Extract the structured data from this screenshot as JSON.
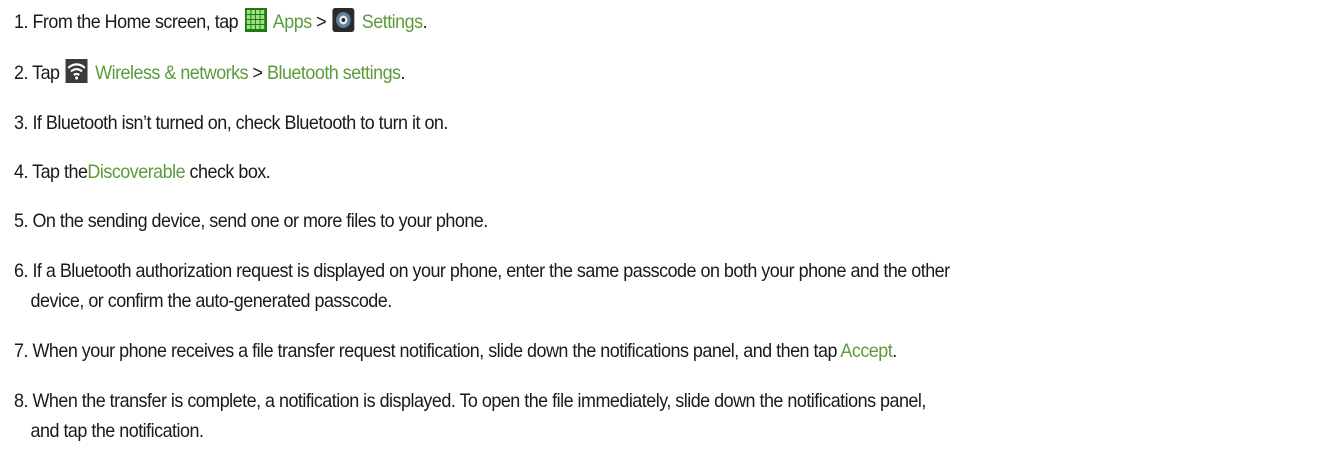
{
  "steps": [
    {
      "number": "1.",
      "text_1": "From the Home screen, tap",
      "icon_1": "apps-grid-icon",
      "link_1": "Apps",
      "sep": ">",
      "icon_2": "settings-gear-icon",
      "link_2": "Settings",
      "end": "."
    },
    {
      "number": "2.",
      "text_1": "Tap",
      "icon_1": "wifi-icon",
      "link_1": "Wireless & networks",
      "sep": ">",
      "link_2": "Bluetooth settings",
      "end": "."
    },
    {
      "number": "3.",
      "text_1": "If Bluetooth isn’t turned on, check Bluetooth to turn it on."
    },
    {
      "number": "4.",
      "text_1": "Tap the",
      "link_1": "Discoverable",
      "text_2": "check box."
    },
    {
      "number": "5.",
      "text_1": "On the sending device, send one or more files to your phone."
    },
    {
      "number": "6.",
      "line_1": "If a Bluetooth authorization request is displayed on your phone, enter the same passcode on both your phone and the other",
      "line_2": "device, or confirm the auto-generated passcode."
    },
    {
      "number": "7.",
      "text_1": "When your phone receives a file transfer request notification, slide down the notifications panel, and then tap",
      "link_1": "Accept",
      "end": "."
    },
    {
      "number": "8.",
      "line_1": "When the transfer is complete, a notification is displayed. To open the file immediately, slide down the notifications panel,",
      "line_2": "and tap the notification."
    }
  ],
  "colors": {
    "link_green": "#5c9a3c",
    "body_text": "#1a1a1a"
  }
}
